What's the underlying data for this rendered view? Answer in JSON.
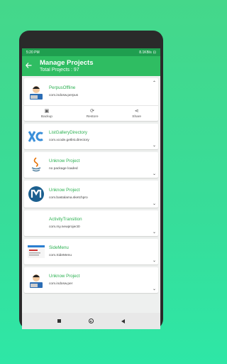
{
  "status_bar": {
    "time": "5:20 PM",
    "network": "8.1KB/s",
    "battery": "⊡"
  },
  "header": {
    "title": "Manage Projects",
    "subtitle": "Total Projects : 97"
  },
  "projects": [
    {
      "name": "PerpusOffline",
      "package": "com.indosw.perpus",
      "icon": "avatar-icon"
    },
    {
      "name": "ListGalleryDirectory",
      "package": "com.xcode.getlist.directory",
      "icon": "xc-logo-icon"
    },
    {
      "name": "Unknow Project",
      "package": "no package loaded",
      "icon": "java-icon"
    },
    {
      "name": "Unknow Project",
      "package": "com.bastalama.sketchpro",
      "icon": "m-logo-icon"
    },
    {
      "name": "ActivityTransition",
      "package": "com.my.newproject0",
      "icon": "blank-icon"
    },
    {
      "name": "SideMenu",
      "package": "com.SideMenu",
      "icon": "app-screenshot-icon"
    },
    {
      "name": "Unknow Project",
      "package": "com.indosw.per",
      "icon": "avatar-icon"
    }
  ],
  "actions": [
    {
      "label": "Backup",
      "icon": "backup-icon"
    },
    {
      "label": "Restore",
      "icon": "restore-icon"
    },
    {
      "label": "Share",
      "icon": "share-icon"
    }
  ],
  "colors": {
    "accent": "#2fbd62",
    "status": "#1f9e4f",
    "name_text": "#2db152"
  }
}
